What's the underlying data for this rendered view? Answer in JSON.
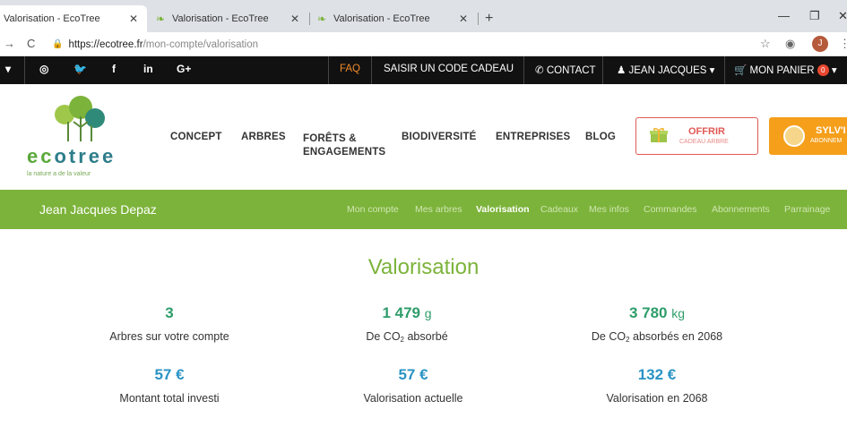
{
  "browser": {
    "tabs": [
      {
        "label": "Valorisation - EcoTree"
      },
      {
        "label": "Valorisation - EcoTree"
      },
      {
        "label": "Valorisation - EcoTree"
      }
    ],
    "url_main": "https://ecotree.fr",
    "url_path": "/mon-compte/valorisation"
  },
  "topbar": {
    "faq": "FAQ",
    "gift_code": "SAISIR UN CODE CADEAU",
    "contact": "CONTACT",
    "user": "JEAN JACQUES",
    "cart": "MON PANIER",
    "cart_count": "0"
  },
  "logo": {
    "word_a": "ec",
    "word_b": "otree",
    "tagline": "la nature a de la valeur"
  },
  "nav": {
    "concept": "CONCEPT",
    "arbres": "ARBRES",
    "forets_1": "FORÊTS &",
    "forets_2": "ENGAGEMENTS",
    "biodiversite": "BIODIVERSITÉ",
    "entreprises": "ENTREPRISES",
    "blog": "BLOG",
    "offrir_title": "OFFRIR",
    "offrir_sub": "CADEAU ARBRE",
    "sylv_title": "SYLV'I",
    "sylv_sub": "ABONNEM"
  },
  "subnav": {
    "user_name": "Jean Jacques Depaz",
    "items": [
      "Mon compte",
      "Mes arbres",
      "Valorisation",
      "Cadeaux",
      "Mes infos",
      "Commandes",
      "Abonnements",
      "Parrainage"
    ]
  },
  "main": {
    "title": "Valorisation",
    "stats": [
      {
        "value": "3",
        "unit": "",
        "label": "Arbres sur votre compte"
      },
      {
        "value": "1 479",
        "unit": "g",
        "label_a": "De CO",
        "label_sub": "2",
        "label_b": " absorbé"
      },
      {
        "value": "3 780",
        "unit": "kg",
        "label_a": "De CO",
        "label_sub": "2",
        "label_b": " absorbés en 2068"
      },
      {
        "value": "57 €",
        "label": "Montant total investi"
      },
      {
        "value": "57 €",
        "label": "Valorisation actuelle"
      },
      {
        "value": "132 €",
        "label": "Valorisation en 2068"
      }
    ]
  },
  "colors": {
    "brand_green": "#7cb33a",
    "stat_green": "#2e9d6a",
    "stat_blue": "#2a93c4",
    "faq_orange": "#f08a2c",
    "offrir_red": "#e05a55",
    "sylv_orange": "#f59f1b"
  }
}
